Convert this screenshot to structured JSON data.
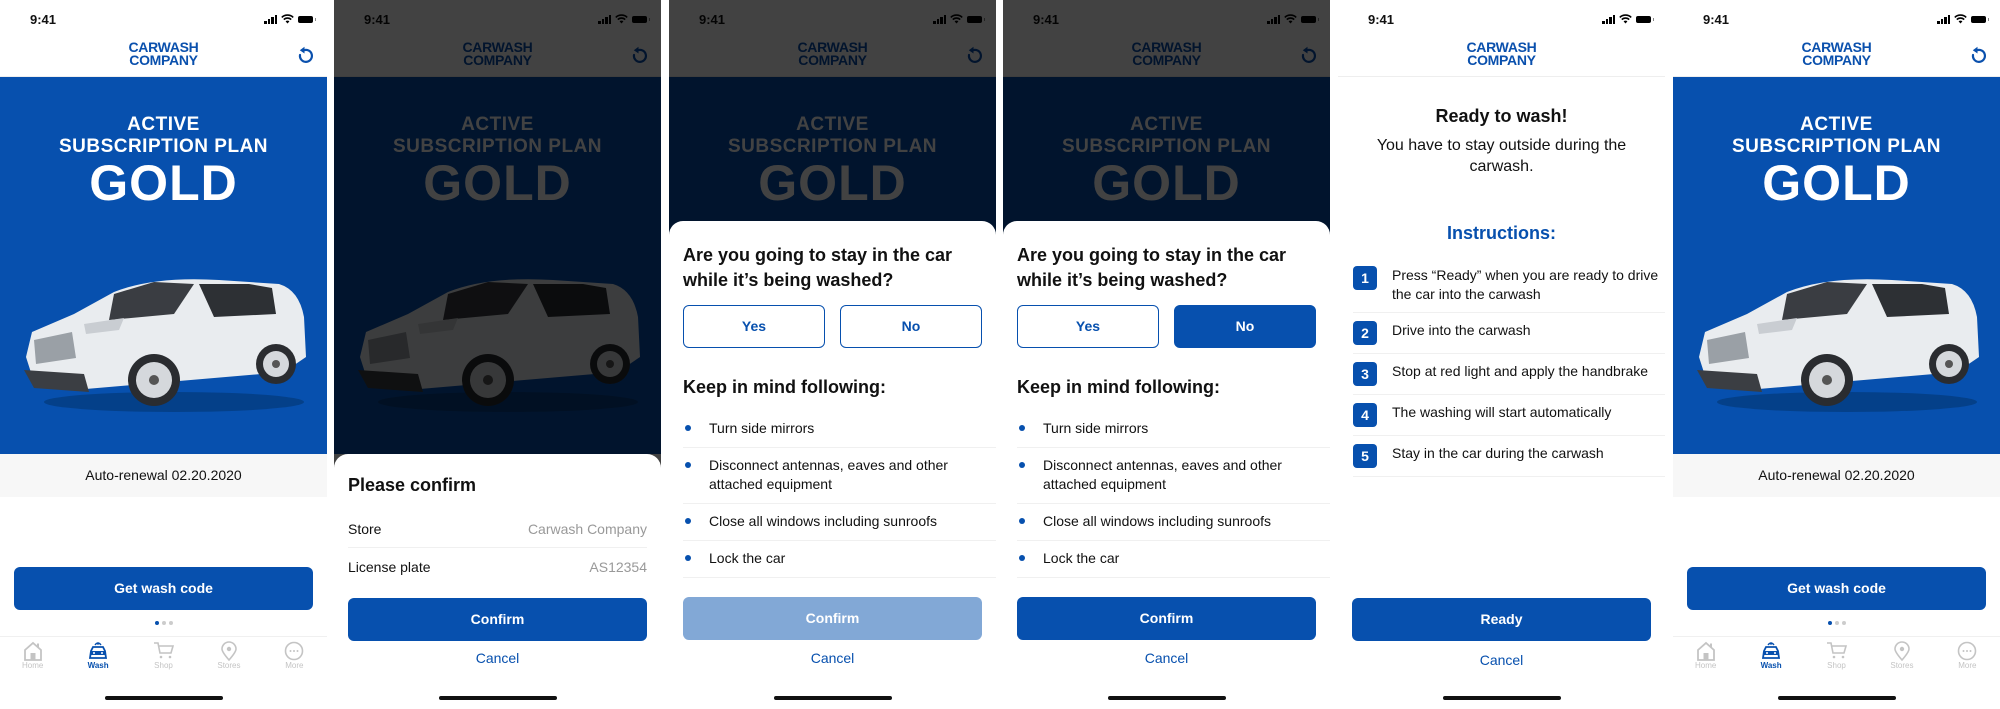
{
  "common": {
    "time": "9:41",
    "logo_line1": "CARWASH",
    "logo_line2": "COMPANY",
    "plan_line1": "ACTIVE",
    "plan_line2": "SUBSCRIPTION PLAN",
    "plan_name": "GOLD",
    "auto_renewal": "Auto-renewal 02.20.2020",
    "get_wash_code": "Get wash code",
    "cancel": "Cancel",
    "confirm": "Confirm",
    "brand_color": "#0750ae",
    "pager": {
      "total": 3,
      "active": 1
    }
  },
  "tabbar": {
    "tabs": [
      {
        "label": "Home",
        "icon": "home-icon"
      },
      {
        "label": "Wash",
        "icon": "car-wash-icon",
        "active": true
      },
      {
        "label": "Shop",
        "icon": "cart-icon"
      },
      {
        "label": "Stores",
        "icon": "location-pin-icon"
      },
      {
        "label": "More",
        "icon": "more-icon"
      }
    ]
  },
  "confirm_sheet": {
    "title": "Please confirm",
    "rows": [
      {
        "label": "Store",
        "value": "Carwash Company"
      },
      {
        "label": "License plate",
        "value": "AS12354"
      }
    ]
  },
  "stay_sheet": {
    "question": "Are you going to stay in the car while it’s being washed?",
    "yes": "Yes",
    "no": "No",
    "keep_in_mind": "Keep in mind following:",
    "items": [
      "Turn side mirrors",
      "Disconnect antennas, eaves and other attached equipment",
      "Close all windows including sunroofs",
      "Lock the car"
    ]
  },
  "ready_screen": {
    "title": "Ready to wash!",
    "subtitle": "You have to stay outside during the carwash.",
    "instructions_title": "Instructions:",
    "steps": [
      "Press “Ready” when you are ready to drive the car into the carwash",
      "Drive into the carwash",
      "Stop at red light and apply the handbrake",
      "The washing will start automatically",
      "Stay in the car during the carwash"
    ],
    "ready_button": "Ready"
  }
}
